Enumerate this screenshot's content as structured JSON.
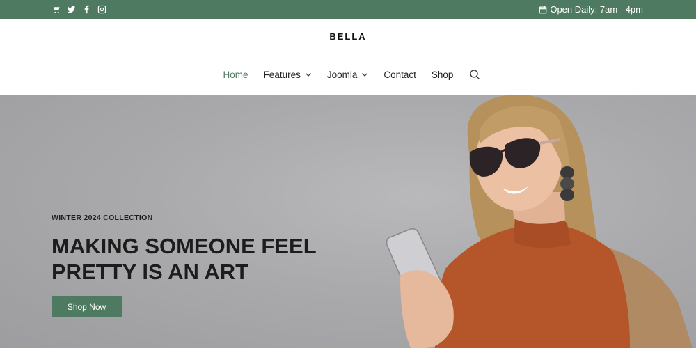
{
  "topbar": {
    "social_icons": [
      "cart-icon",
      "twitter-icon",
      "facebook-icon",
      "instagram-icon"
    ],
    "hours_text": "Open Daily: 7am - 4pm",
    "background_color": "#4e7a61"
  },
  "header": {
    "brand": "BELLA",
    "nav": [
      {
        "label": "Home",
        "active": true
      },
      {
        "label": "Features",
        "dropdown": true
      },
      {
        "label": "Joomla",
        "dropdown": true
      },
      {
        "label": "Contact"
      },
      {
        "label": "Shop"
      }
    ],
    "accent_color": "#4e7a61"
  },
  "hero": {
    "eyebrow": "WINTER 2024 COLLECTION",
    "headline_line1": "MAKING SOMEONE FEEL",
    "headline_line2": "PRETTY IS AN ART",
    "button_label": "Shop Now"
  }
}
